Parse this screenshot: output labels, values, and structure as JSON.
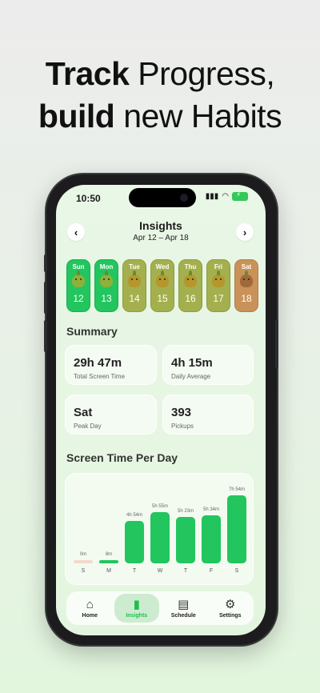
{
  "headline": {
    "line1_bold": "Track",
    "line1_rest": "Progress,",
    "line2_bold": "build",
    "line2_rest": "new Habits"
  },
  "status": {
    "time": "10:50"
  },
  "header": {
    "title": "Insights",
    "range": "Apr 12 – Apr 18",
    "prev_icon": "chevron-left-icon",
    "next_icon": "chevron-right-icon"
  },
  "days": [
    {
      "name": "Sun",
      "num": "12",
      "color": "#22c55e",
      "pet": "#8fb03a"
    },
    {
      "name": "Mon",
      "num": "13",
      "color": "#22c55e",
      "pet": "#8fb03a"
    },
    {
      "name": "Tue",
      "num": "14",
      "color": "#a3b04d",
      "pet": "#b5972c"
    },
    {
      "name": "Wed",
      "num": "15",
      "color": "#a3b04d",
      "pet": "#b5972c"
    },
    {
      "name": "Thu",
      "num": "16",
      "color": "#a3b04d",
      "pet": "#b5972c"
    },
    {
      "name": "Fri",
      "num": "17",
      "color": "#a3b04d",
      "pet": "#b5972c"
    },
    {
      "name": "Sat",
      "num": "18",
      "color": "#c99258",
      "pet": "#a0693a"
    }
  ],
  "summary": {
    "title": "Summary",
    "cards": [
      {
        "value": "29h 47m",
        "label": "Total Screen Time"
      },
      {
        "value": "4h 15m",
        "label": "Daily Average"
      },
      {
        "value": "Sat",
        "label": "Peak Day"
      },
      {
        "value": "393",
        "label": "Pickups"
      }
    ]
  },
  "chart_title": "Screen Time Per Day",
  "chart_data": {
    "type": "bar",
    "categories": [
      "S",
      "M",
      "T",
      "W",
      "T",
      "F",
      "S"
    ],
    "values": [
      0,
      8,
      294,
      355,
      323,
      334,
      474
    ],
    "value_labels": [
      "0m",
      "8m",
      "4h 54m",
      "5h 55m",
      "5h 23m",
      "5h 34m",
      "7h 54m"
    ],
    "colors": [
      "#f3d9c9",
      "#22c55e",
      "#22c55e",
      "#22c55e",
      "#22c55e",
      "#22c55e",
      "#22c55e"
    ],
    "ylim": [
      0,
      500
    ]
  },
  "tabs": [
    {
      "label": "Home",
      "icon": "house-icon",
      "glyph": "⌂",
      "active": false
    },
    {
      "label": "Insights",
      "icon": "bar-chart-icon",
      "glyph": "▮",
      "active": true
    },
    {
      "label": "Schedule",
      "icon": "clipboard-icon",
      "glyph": "▤",
      "active": false
    },
    {
      "label": "Settings",
      "icon": "gear-icon",
      "glyph": "⚙",
      "active": false
    }
  ]
}
